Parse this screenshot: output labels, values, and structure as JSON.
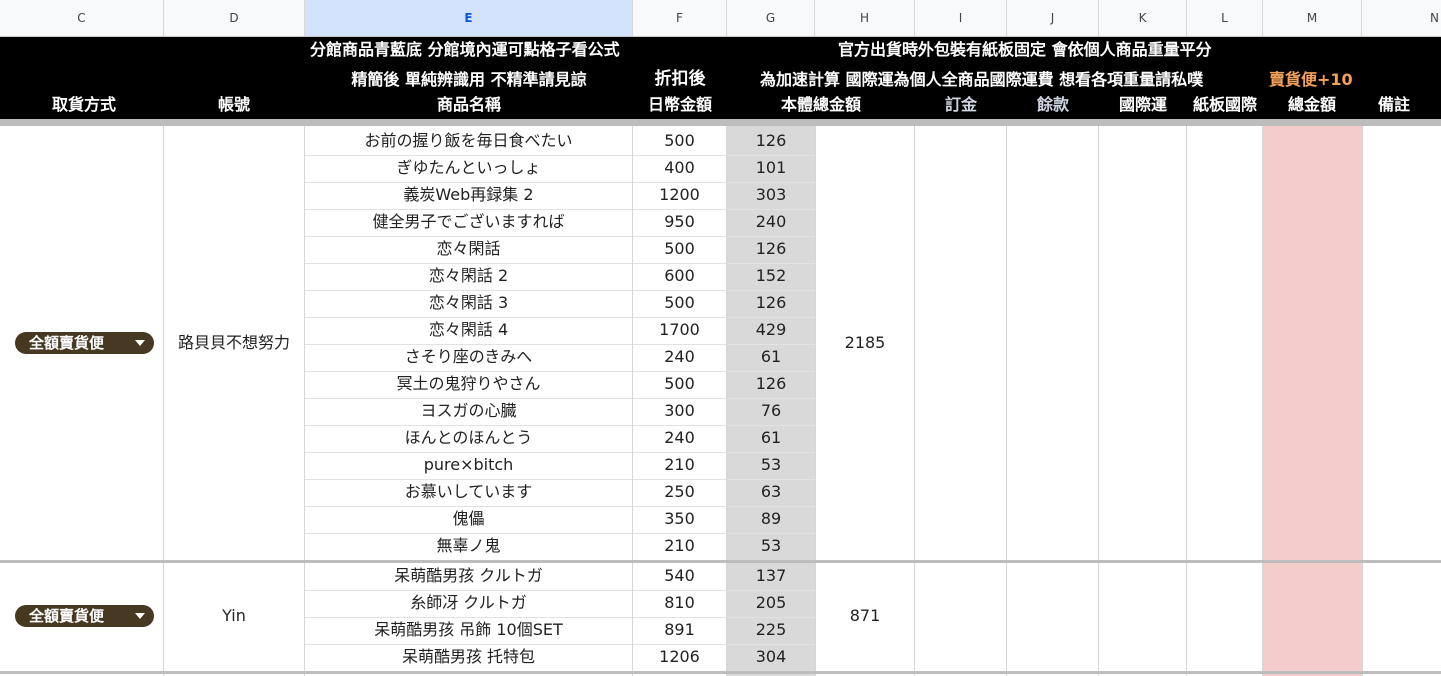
{
  "column_headers": [
    "C",
    "D",
    "E",
    "F",
    "G",
    "H",
    "I",
    "J",
    "K",
    "L",
    "M",
    "N"
  ],
  "header": {
    "line1_e": "分館商品青藍底 分館境內運可點格子看公式",
    "line1_h": "官方出貨時外包裝有紙板固定 會依個人商品重量平分",
    "line2_e": "精簡後 單純辨識用 不精準請見諒",
    "line2_f": "折扣後",
    "line2_h": "為加速計算 國際運為個人全商品國際運費 想看各項重量請私噗",
    "line2_m": "賣貨便+10",
    "col_c": "取貨方式",
    "col_d": "帳號",
    "col_e": "商品名稱",
    "col_f": "日幣金額",
    "col_h": "本體總金額",
    "col_i": "訂金",
    "col_j": "餘款",
    "col_k": "國際運",
    "col_l": "紙板國際",
    "col_m": "總金額",
    "col_n": "備註"
  },
  "groups": [
    {
      "pickup": "全額賣貨便",
      "account": "路貝貝不想努力",
      "total": "2185",
      "items": [
        {
          "name": "お前の握り飯を毎日食べたい",
          "jpy": "500",
          "g": "126"
        },
        {
          "name": "ぎゆたんといっしょ",
          "jpy": "400",
          "g": "101"
        },
        {
          "name": "義炭Web再録集 2",
          "jpy": "1200",
          "g": "303"
        },
        {
          "name": "健全男子でございますれば",
          "jpy": "950",
          "g": "240"
        },
        {
          "name": "恋々閑話",
          "jpy": "500",
          "g": "126"
        },
        {
          "name": "恋々閑話 2",
          "jpy": "600",
          "g": "152"
        },
        {
          "name": "恋々閑話 3",
          "jpy": "500",
          "g": "126"
        },
        {
          "name": "恋々閑話 4",
          "jpy": "1700",
          "g": "429"
        },
        {
          "name": "さそり座のきみへ",
          "jpy": "240",
          "g": "61"
        },
        {
          "name": "冥土の鬼狩りやさん",
          "jpy": "500",
          "g": "126"
        },
        {
          "name": "ヨスガの心臓",
          "jpy": "300",
          "g": "76"
        },
        {
          "name": "ほんとのほんとう",
          "jpy": "240",
          "g": "61"
        },
        {
          "name": "pure×bitch",
          "jpy": "210",
          "g": "53"
        },
        {
          "name": "お慕いしています",
          "jpy": "250",
          "g": "63"
        },
        {
          "name": "傀儡",
          "jpy": "350",
          "g": "89"
        },
        {
          "name": "無辜ノ鬼",
          "jpy": "210",
          "g": "53"
        }
      ]
    },
    {
      "pickup": "全額賣貨便",
      "account": "Yin",
      "total": "871",
      "items": [
        {
          "name": "呆萌酷男孩 クルトガ",
          "jpy": "540",
          "g": "137"
        },
        {
          "name": "糸師冴 クルトガ",
          "jpy": "810",
          "g": "205"
        },
        {
          "name": "呆萌酷男孩 吊飾 10個SET",
          "jpy": "891",
          "g": "225"
        },
        {
          "name": "呆萌酷男孩 托特包",
          "jpy": "1206",
          "g": "304"
        }
      ]
    }
  ]
}
